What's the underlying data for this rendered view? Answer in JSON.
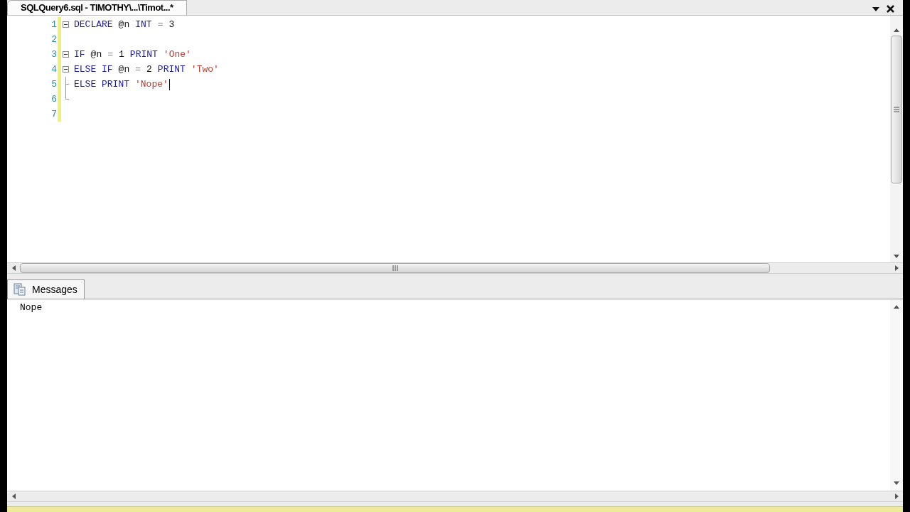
{
  "document_tab": {
    "title": "SQLQuery6.sql - TIMOTHY\\...\\Timot...*",
    "selected": true
  },
  "editor": {
    "lines": [
      {
        "number": "1",
        "collapsible": true,
        "caret": false,
        "tokens": [
          {
            "kind": "keyword",
            "text": "DECLARE"
          },
          {
            "kind": "plain",
            "text": "@n"
          },
          {
            "kind": "keyword",
            "text": "INT"
          },
          {
            "kind": "operator",
            "text": "="
          },
          {
            "kind": "plain",
            "text": "3"
          }
        ]
      },
      {
        "number": "2",
        "collapsible": false,
        "caret": false
      },
      {
        "number": "3",
        "collapsible": true,
        "caret": false,
        "tokens": [
          {
            "kind": "keyword",
            "text": "IF"
          },
          {
            "kind": "plain",
            "text": "@n"
          },
          {
            "kind": "operator",
            "text": "="
          },
          {
            "kind": "plain",
            "text": "1"
          },
          {
            "kind": "keyword",
            "text": "PRINT"
          },
          {
            "kind": "string",
            "text": "'One'"
          }
        ]
      },
      {
        "number": "4",
        "collapsible": true,
        "caret": false,
        "tokens": [
          {
            "kind": "keyword",
            "text": "ELSE IF"
          },
          {
            "kind": "plain",
            "text": "@n"
          },
          {
            "kind": "operator",
            "text": "="
          },
          {
            "kind": "plain",
            "text": "2"
          },
          {
            "kind": "keyword",
            "text": "PRINT"
          },
          {
            "kind": "string",
            "text": "'Two'"
          }
        ]
      },
      {
        "number": "5",
        "collapsible": false,
        "caret": true,
        "tokens": [
          {
            "kind": "keyword",
            "text": "ELSE PRINT"
          },
          {
            "kind": "string",
            "text": "'Nope'"
          }
        ]
      },
      {
        "number": "6",
        "collapsible": false,
        "caret": false
      },
      {
        "number": "7",
        "collapsible": false,
        "caret": false
      }
    ]
  },
  "results_tab": {
    "label": "Messages",
    "selected": true
  },
  "messages": [
    "Nope"
  ]
}
